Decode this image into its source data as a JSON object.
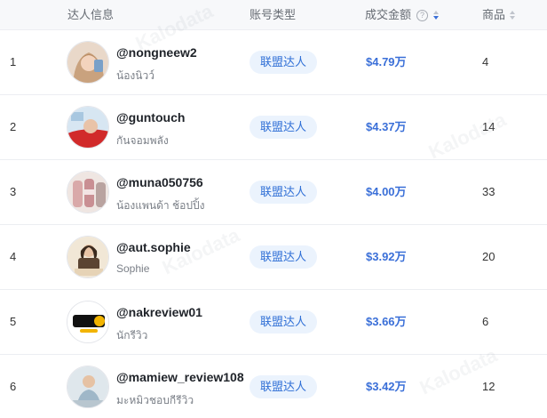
{
  "header": {
    "col_info": "达人信息",
    "col_type": "账号类型",
    "col_gmv": "成交金额",
    "col_items": "商品"
  },
  "watermark": "Kalodata",
  "rows": [
    {
      "rank": "1",
      "handle": "@nongneew2",
      "nickname": "น้องนิวว์",
      "type": "联盟达人",
      "gmv": "$4.79万",
      "items": "4"
    },
    {
      "rank": "2",
      "handle": "@guntouch",
      "nickname": "กันจอมพลัง",
      "type": "联盟达人",
      "gmv": "$4.37万",
      "items": "14"
    },
    {
      "rank": "3",
      "handle": "@muna050756",
      "nickname": "น้องแพนด้า ช้อปปิ้ง",
      "type": "联盟达人",
      "gmv": "$4.00万",
      "items": "33"
    },
    {
      "rank": "4",
      "handle": "@aut.sophie",
      "nickname": "Sophie",
      "type": "联盟达人",
      "gmv": "$3.92万",
      "items": "20"
    },
    {
      "rank": "5",
      "handle": "@nakreview01",
      "nickname": "นักรีวิว",
      "type": "联盟达人",
      "gmv": "$3.66万",
      "items": "6"
    },
    {
      "rank": "6",
      "handle": "@mamiew_review108",
      "nickname": "มะหมิวชอบกีรีวิว",
      "type": "联盟达人",
      "gmv": "$3.42万",
      "items": "12"
    }
  ]
}
